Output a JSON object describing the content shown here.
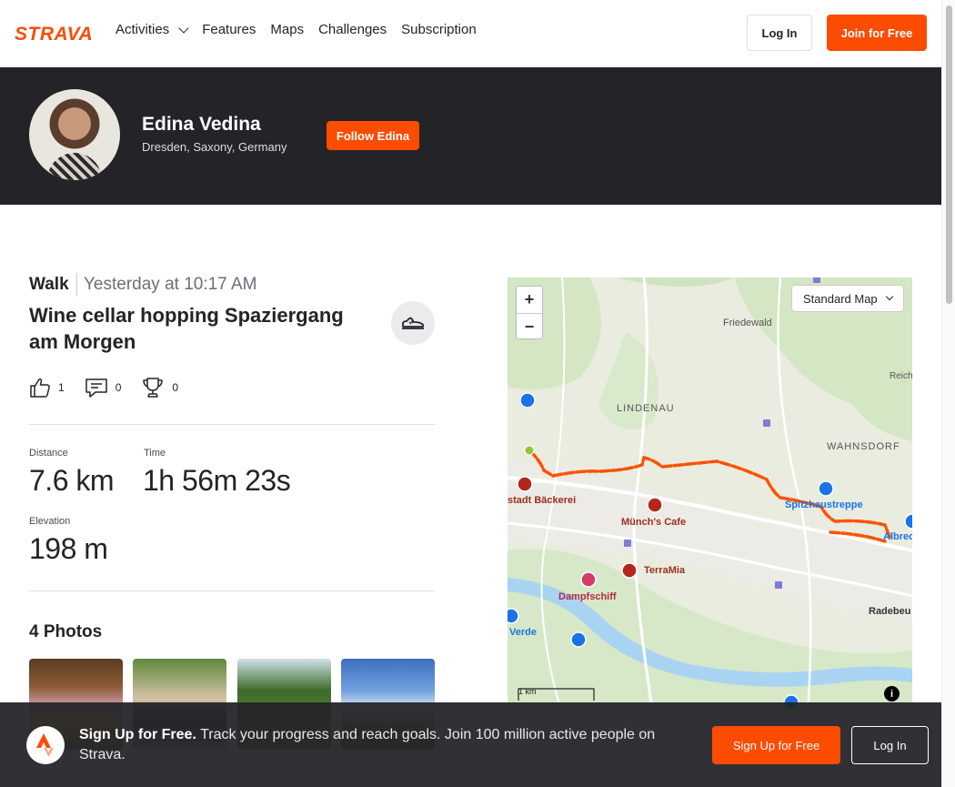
{
  "nav": {
    "logo": "STRAVA",
    "links": [
      "Activities",
      "Features",
      "Maps",
      "Challenges",
      "Subscription"
    ],
    "login": "Log In",
    "join": "Join for Free"
  },
  "athlete": {
    "name": "Edina Vedina",
    "location": "Dresden, Saxony, Germany",
    "follow": "Follow Edina"
  },
  "activity": {
    "type": "Walk",
    "time": "Yesterday at 10:17 AM",
    "title": "Wine cellar hopping Spaziergang am Morgen",
    "kudos": "1",
    "comments": "0",
    "achievements": "0",
    "stats": {
      "distance_label": "Distance",
      "distance_value": "7.6 km",
      "time_label": "Time",
      "time_value": "1h 56m 23s",
      "elevation_label": "Elevation",
      "elevation_value": "198 m"
    },
    "photos_title": "4 Photos"
  },
  "map": {
    "style_select": "Standard Map",
    "zoom_in": "+",
    "zoom_out": "−",
    "scale": "1 km",
    "places": {
      "friedewald": "Friedewald",
      "lindenau": "LINDENAU",
      "wahnsdorf": "WAHNSDORF",
      "reich": "Reich",
      "radebeu": "Radebeu",
      "baeckerei": "stadt Bäckerei",
      "muench": "Münch's Cafe",
      "spitzhaustreppe": "Spitzhaustreppe",
      "albrec": "Albrec",
      "terramia": "TerraMia",
      "dampfschiff": "Dampfschiff",
      "verde": "Verde"
    },
    "info": "i",
    "route_color": "#fc5200"
  },
  "banner": {
    "headline": "Sign Up for Free.",
    "body": "Track your progress and reach goals. Join 100 million active people on Strava.",
    "signup": "Sign Up for Free",
    "login": "Log In"
  },
  "colors": {
    "brand": "#fc4c02",
    "dark": "#242428"
  }
}
